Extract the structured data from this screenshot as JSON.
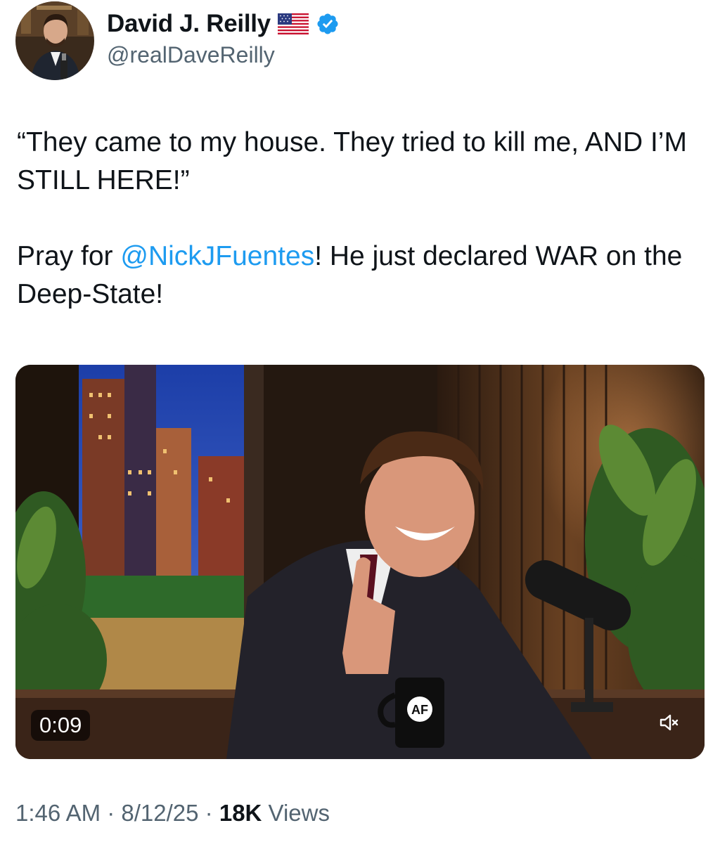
{
  "author": {
    "display_name": "David J. Reilly",
    "handle": "@realDaveReilly",
    "flag_icon": "us-flag-emoji",
    "verified_icon": "verified-badge",
    "verified_color": "#1d9bf0"
  },
  "tweet": {
    "line1": "“They came to my house. They tried to kill me, AND I’M STILL HERE!”",
    "line2_prefix": "Pray for ",
    "mention": "@NickJFuentes",
    "line2_suffix": "! He just declared WAR on the Deep-State!",
    "mention_color": "#1d9bf0"
  },
  "video": {
    "duration": "0:09",
    "mute_icon": "speaker-muted-icon",
    "mug_logo": "AF"
  },
  "meta": {
    "time": "1:46 AM",
    "separator": " · ",
    "date": "8/12/25",
    "views_count": "18K",
    "views_label": " Views"
  }
}
